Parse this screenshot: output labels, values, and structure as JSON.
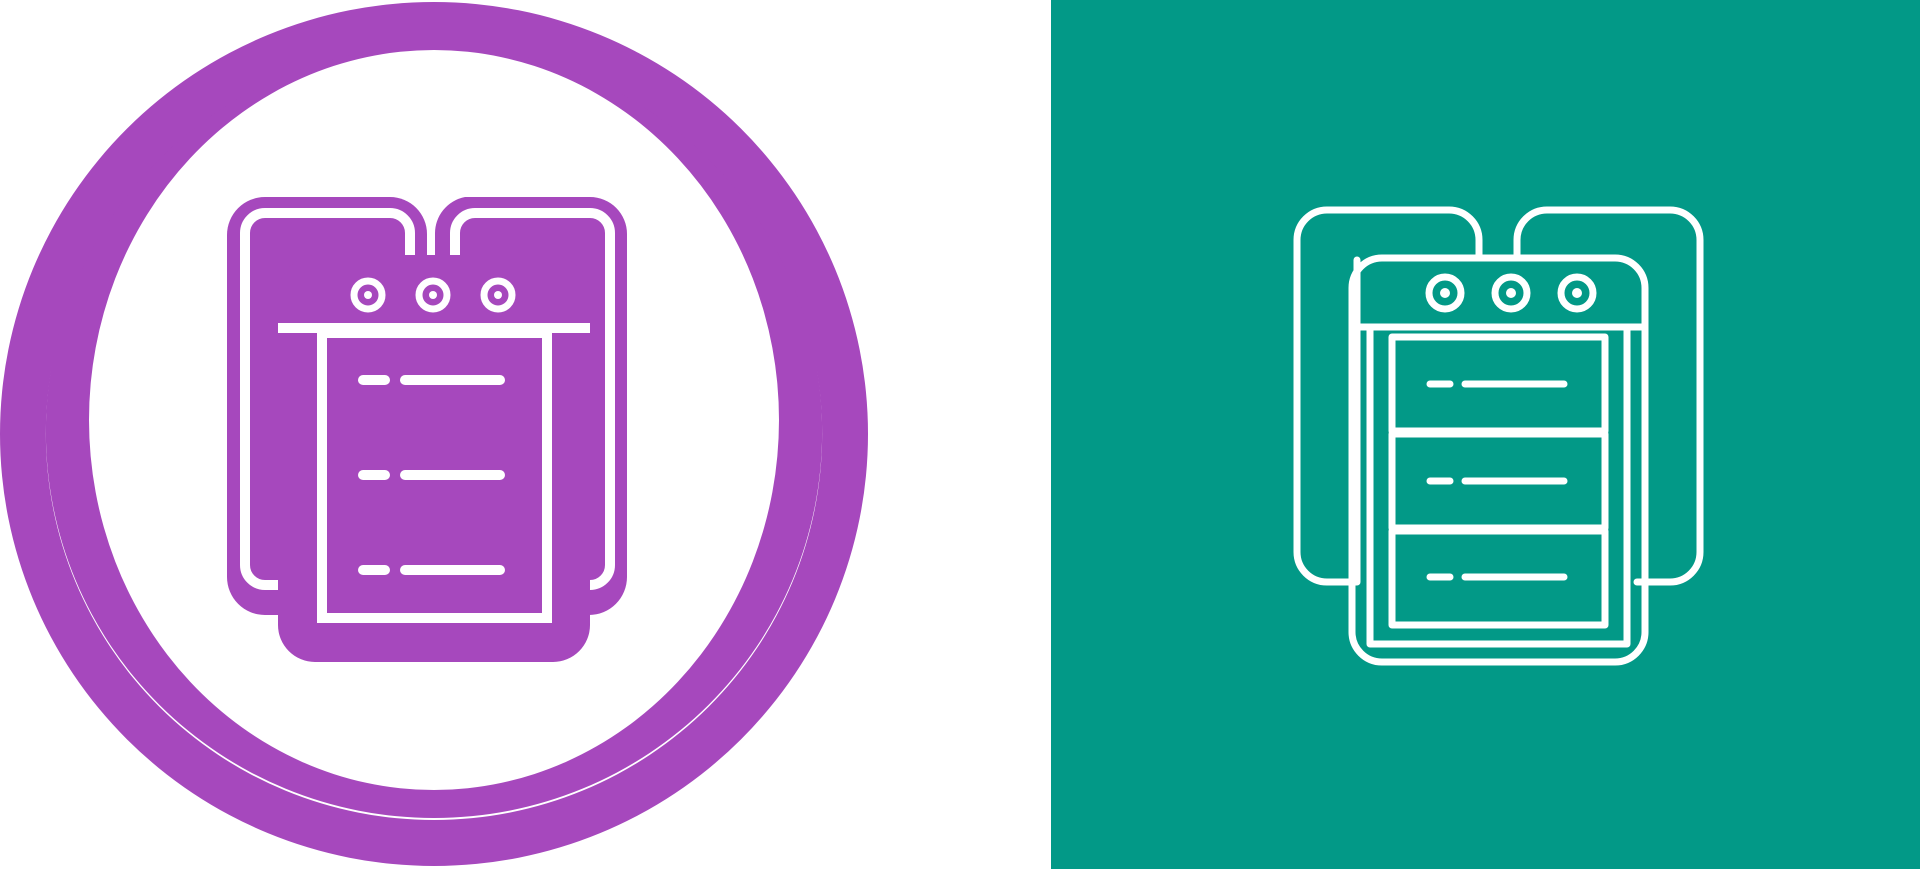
{
  "left_variant": {
    "style": "glyph-in-ring",
    "icon": "server-rack-icon",
    "background": "#ffffff",
    "accent": "#a648bd"
  },
  "right_variant": {
    "style": "outline",
    "icon": "server-rack-icon",
    "background": "#029987",
    "accent": "#ffffff"
  }
}
